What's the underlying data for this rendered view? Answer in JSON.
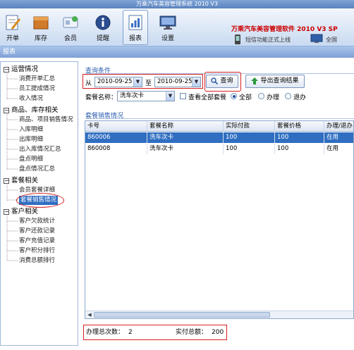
{
  "window": {
    "title": "万乘汽车美容管理系统 2010 V3"
  },
  "toolbar": {
    "buttons": [
      {
        "label": "开单",
        "icon": "document-pen-icon"
      },
      {
        "label": "库存",
        "icon": "box-icon"
      },
      {
        "label": "会员",
        "icon": "member-card-icon"
      },
      {
        "label": "提醒",
        "icon": "info-icon"
      },
      {
        "label": "报表",
        "icon": "report-icon",
        "active": true
      },
      {
        "label": "设置",
        "icon": "monitor-icon"
      }
    ],
    "brand": {
      "title": "万乘汽车美容管理软件 2010 V3 SP",
      "slogan": "短信功能正式上线",
      "right": "全国"
    }
  },
  "section": {
    "title": "报表"
  },
  "sidebar": {
    "groups": [
      {
        "label": "运营情况",
        "items": [
          "消费开单汇总",
          "员工提成情况",
          "收入情况"
        ]
      },
      {
        "label": "商品、库存相关",
        "items": [
          "商品、项目销售情况",
          "入库明细",
          "出库明细",
          "出入库情况汇总",
          "盘点明细",
          "盘点情况汇总"
        ]
      },
      {
        "label": "套餐相关",
        "items": [
          "会员套餐详细",
          "套餐销售情况"
        ]
      },
      {
        "label": "客户相关",
        "items": [
          "客户欠款统计",
          "客户还款记录",
          "客户充值记录",
          "客户积分排行",
          "消费总额排行"
        ]
      }
    ],
    "selected": "套餐销售情况"
  },
  "query": {
    "group_label": "查询条件",
    "from_label": "从",
    "from_date": "2010-09-25",
    "to_label": "至",
    "to_date": "2010-09-25",
    "search_button": "查询",
    "export_button": "导出查询结果",
    "package_label": "套餐名称：",
    "package_value": "洗车次卡",
    "view_all_label": "查看全部套餐",
    "radio_all": "全部",
    "radio_processing": "办理",
    "radio_refund": "退办",
    "radio_selected": "全部"
  },
  "results": {
    "group_label": "套餐销售情况",
    "columns": [
      "卡号",
      "套餐名称",
      "实际付款",
      "套餐价格",
      "办理/退办"
    ],
    "rows": [
      [
        "860006",
        "洗车次卡",
        "100",
        "100",
        "在用"
      ],
      [
        "860008",
        "洗车次卡",
        "100",
        "100",
        "在用"
      ]
    ],
    "selected_row": 0
  },
  "summary": {
    "count_label": "办理总次数：",
    "count_value": "2",
    "total_label": "实付总额：",
    "total_value": "200"
  }
}
